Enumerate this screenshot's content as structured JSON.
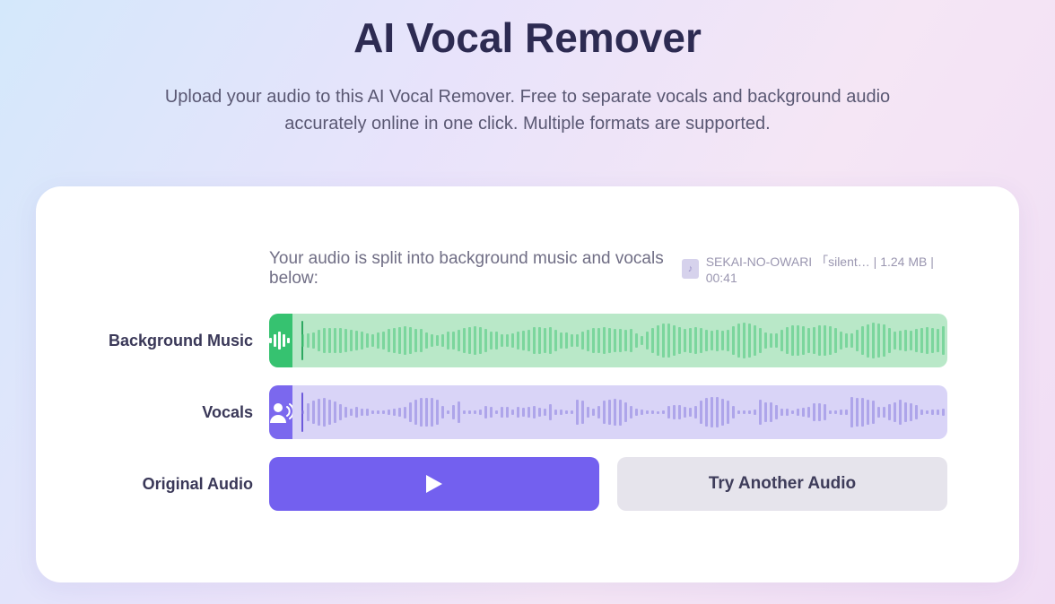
{
  "header": {
    "title": "AI Vocal Remover",
    "description": "Upload your audio to this AI Vocal Remover. Free to separate vocals and background audio accurately online in one click. Multiple formats are supported."
  },
  "result": {
    "split_message": "Your audio is split into background music and vocals below:",
    "file": {
      "name": "SEKAI-NO-OWARI 「silent…",
      "size": "1.24 MB",
      "duration": "00:41"
    },
    "tracks": {
      "background": {
        "label": "Background Music"
      },
      "vocals": {
        "label": "Vocals"
      },
      "original": {
        "label": "Original Audio"
      }
    },
    "buttons": {
      "try_another": "Try Another Audio"
    }
  }
}
